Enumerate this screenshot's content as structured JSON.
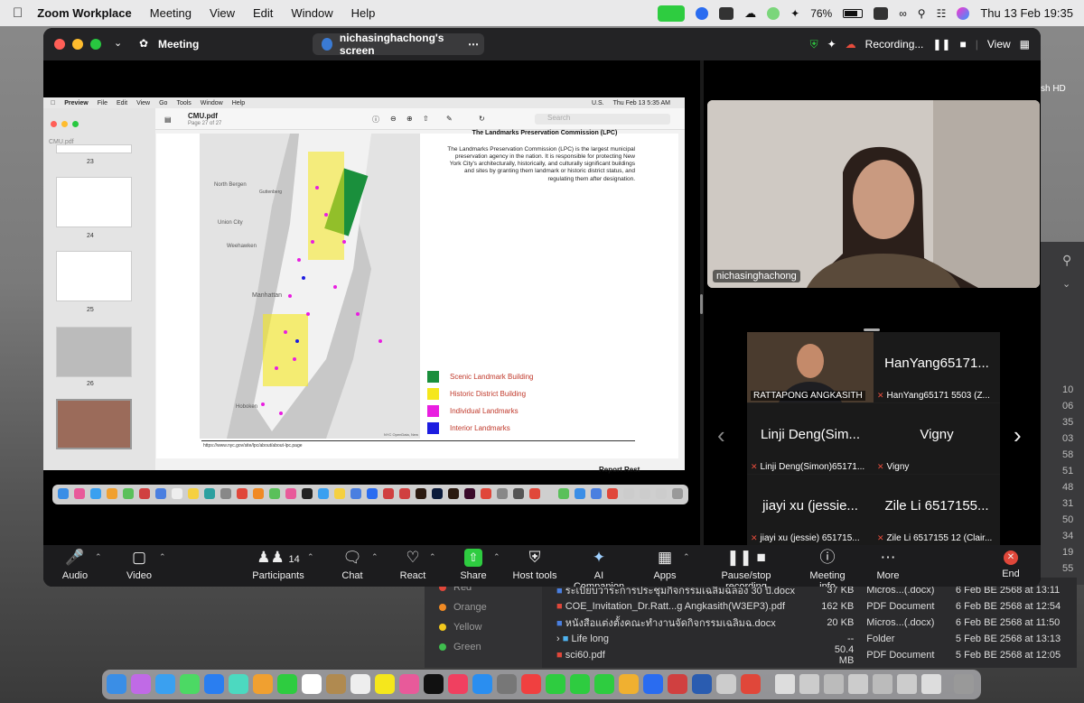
{
  "menubar": {
    "app": "Zoom Workplace",
    "items": [
      "Meeting",
      "View",
      "Edit",
      "Window",
      "Help"
    ],
    "battery": "76%",
    "datetime": "Thu 13 Feb  19:35"
  },
  "zoom": {
    "title": "Meeting",
    "screen_label": "nichasinghachong's screen",
    "recording_label": "Recording...",
    "view_label": "View"
  },
  "shared_screen": {
    "menu": [
      "Preview",
      "File",
      "Edit",
      "View",
      "Go",
      "Tools",
      "Window",
      "Help"
    ],
    "menu_time": "Thu Feb 13  5:35 AM",
    "menu_locale": "U.S.",
    "doc_title": "CMU.pdf",
    "doc_page": "Page 27 of 27",
    "search_placeholder": "Search",
    "sidebar_file": "CMU.pdf",
    "thumb_numbers": [
      "23",
      "24",
      "25",
      "26"
    ],
    "heading": "The Landmarks Preservation Commission (LPC)",
    "paragraph": "The Landmarks Preservation Commission (LPC) is the largest municipal preservation agency in the nation. It is responsible for protecting New York City's architecturally, historically, and culturally significant buildings and sites by granting them landmark or historic district status, and regulating them after designation.",
    "legend": [
      {
        "label": "Scenic Landmark Building",
        "color": "#1a8f3c"
      },
      {
        "label": "Historic District Building",
        "color": "#f5e71c"
      },
      {
        "label": "Individual Landmarks",
        "color": "#e91ee0"
      },
      {
        "label": "Interior Landmarks",
        "color": "#1c1ce0"
      }
    ],
    "map_labels": [
      "North Bergen",
      "Union City",
      "Weehawken",
      "Manhattan",
      "Guttenberg",
      "Hoboken"
    ],
    "source_url": "https://www.nyc.gov/site/lpc/about/about-lpc.page",
    "map_credit": "NYC OpenData, New",
    "next_page_fragment": "Report Rest"
  },
  "video": {
    "main_name": "nichasinghachong"
  },
  "gallery": [
    {
      "big": "",
      "small": "RATTAPONG ANGKASITH",
      "video": true
    },
    {
      "big": "HanYang65171...",
      "small": "HanYang65171 5503  (Z...",
      "video": false
    },
    {
      "big": "Linji Deng(Sim...",
      "small": "Linji Deng(Simon)65171...",
      "video": false
    },
    {
      "big": "Vigny",
      "small": "Vigny",
      "video": false
    },
    {
      "big": "jiayi xu  (jessie...",
      "small": "jiayi xu  (jessie)  651715...",
      "video": false
    },
    {
      "big": "Zile Li 6517155...",
      "small": "Zile Li 6517155 12  (Clair...",
      "video": false
    }
  ],
  "controls": {
    "audio": "Audio",
    "video": "Video",
    "participants": "Participants",
    "participants_count": "14",
    "chat": "Chat",
    "react": "React",
    "share": "Share",
    "host_tools": "Host tools",
    "ai_companion": "AI Companion",
    "apps": "Apps",
    "pause_recording": "Pause/stop recording",
    "meeting_info": "Meeting info",
    "more": "More",
    "end": "End"
  },
  "finder": {
    "tags": [
      {
        "name": "Red",
        "color": "#e0473a"
      },
      {
        "name": "Orange",
        "color": "#f08a24"
      },
      {
        "name": "Yellow",
        "color": "#f2c81d"
      },
      {
        "name": "Green",
        "color": "#3fbd4e"
      }
    ],
    "files": [
      {
        "name": "ระเบียบวาระการประชุมกิจกรรมเฉลิมฉลอง 30 ปี.docx",
        "size": "37 KB",
        "kind": "Micros...(.docx)",
        "date": "6 Feb BE 2568 at 13:11"
      },
      {
        "name": "COE_Invitation_Dr.Ratt...g Angkasith(W3EP3).pdf",
        "size": "162 KB",
        "kind": "PDF Document",
        "date": "6 Feb BE 2568 at 12:54"
      },
      {
        "name": "หนังสือแต่งตั้งคณะทำงานจัดกิจกรรมเฉลิมฉ.docx",
        "size": "20 KB",
        "kind": "Micros...(.docx)",
        "date": "6 Feb BE 2568 at 11:50"
      },
      {
        "name": "Life long",
        "size": "--",
        "kind": "Folder",
        "date": "5 Feb BE 2568 at 13:13"
      },
      {
        "name": "sci60.pdf",
        "size": "50.4 MB",
        "kind": "PDF Document",
        "date": "5 Feb BE 2568 at 12:05"
      }
    ],
    "side_numbers": [
      "10",
      "06",
      "35",
      "03",
      "58",
      "51",
      "48",
      "31",
      "50",
      "34",
      "19",
      "55"
    ],
    "disk_label": "sh HD"
  }
}
